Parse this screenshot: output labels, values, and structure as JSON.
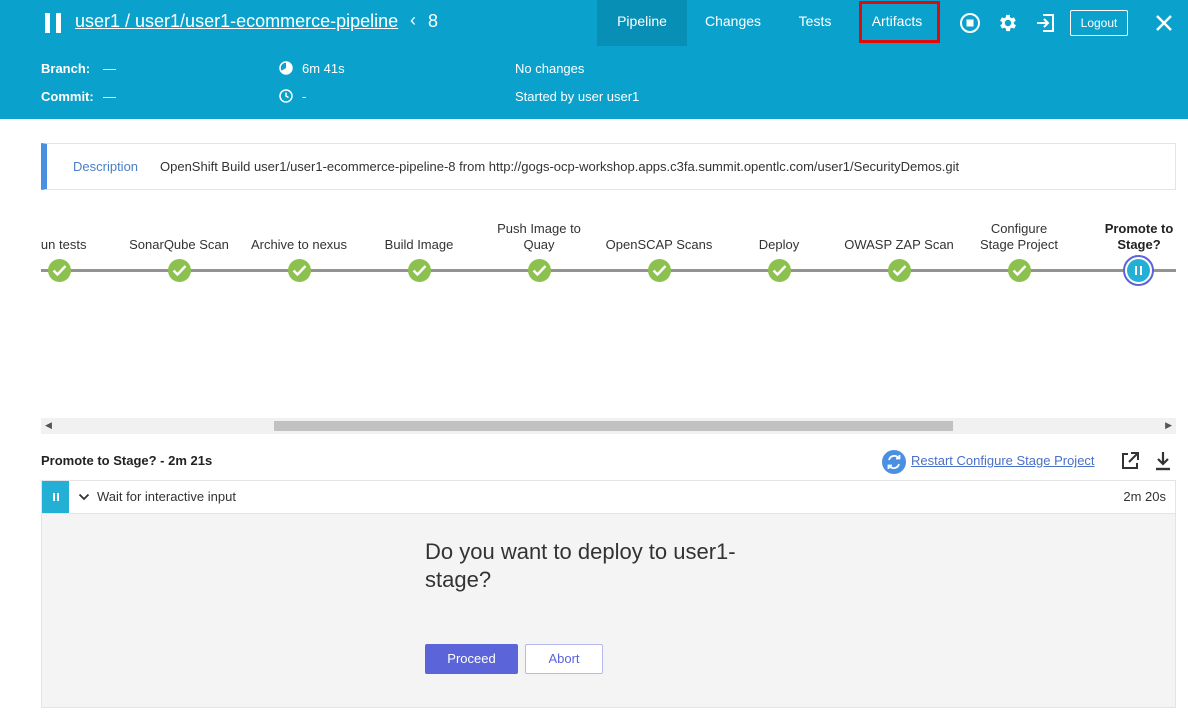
{
  "header": {
    "breadcrumb": "user1 / user1/user1-ecommerce-pipeline",
    "back_glyph": "‹",
    "run_number": "8",
    "tabs": [
      {
        "label": "Pipeline",
        "active": true
      },
      {
        "label": "Changes",
        "active": false
      },
      {
        "label": "Tests",
        "active": false
      },
      {
        "label": "Artifacts",
        "active": false,
        "annotated": true
      }
    ],
    "icons": [
      "stop-icon",
      "gear-icon",
      "exit-icon",
      "close-icon"
    ],
    "logout_label": "Logout"
  },
  "summary": {
    "branch_label": "Branch:",
    "branch_value": "—",
    "commit_label": "Commit:",
    "commit_value": "—",
    "duration": "6m 41s",
    "started_ago": "-",
    "changes": "No changes",
    "started_by": "Started by user user1"
  },
  "description": {
    "label": "Description",
    "text": "OpenShift Build user1/user1-ecommerce-pipeline-8 from http://gogs-ocp-workshop.apps.c3fa.summit.opentlc.com/user1/SecurityDemos.git"
  },
  "pipeline": {
    "stages": [
      {
        "name": "Run tests",
        "status": "success"
      },
      {
        "name": "SonarQube Scan",
        "status": "success"
      },
      {
        "name": "Archive to nexus",
        "status": "success"
      },
      {
        "name": "Build Image",
        "status": "success"
      },
      {
        "name": "Push Image to Quay",
        "status": "success"
      },
      {
        "name": "OpenSCAP Scans",
        "status": "success"
      },
      {
        "name": "Deploy",
        "status": "success"
      },
      {
        "name": "OWASP ZAP Scan",
        "status": "success"
      },
      {
        "name": "Configure Stage Project",
        "status": "success"
      },
      {
        "name": "Promote to Stage?",
        "status": "paused",
        "selected": true
      }
    ]
  },
  "step_detail": {
    "title": "Promote to Stage? - 2m 21s",
    "restart_label": "Restart Configure Stage Project",
    "step_name": "Wait for interactive input",
    "step_time": "2m 20s",
    "question": "Do you want to deploy to user1-stage?",
    "proceed_label": "Proceed",
    "abort_label": "Abort"
  },
  "colors": {
    "header_bg": "#0aa2cc",
    "success": "#8cc04f",
    "paused": "#24b0d5",
    "primary_button": "#5c64d9",
    "annotation": "#e00a0a"
  }
}
